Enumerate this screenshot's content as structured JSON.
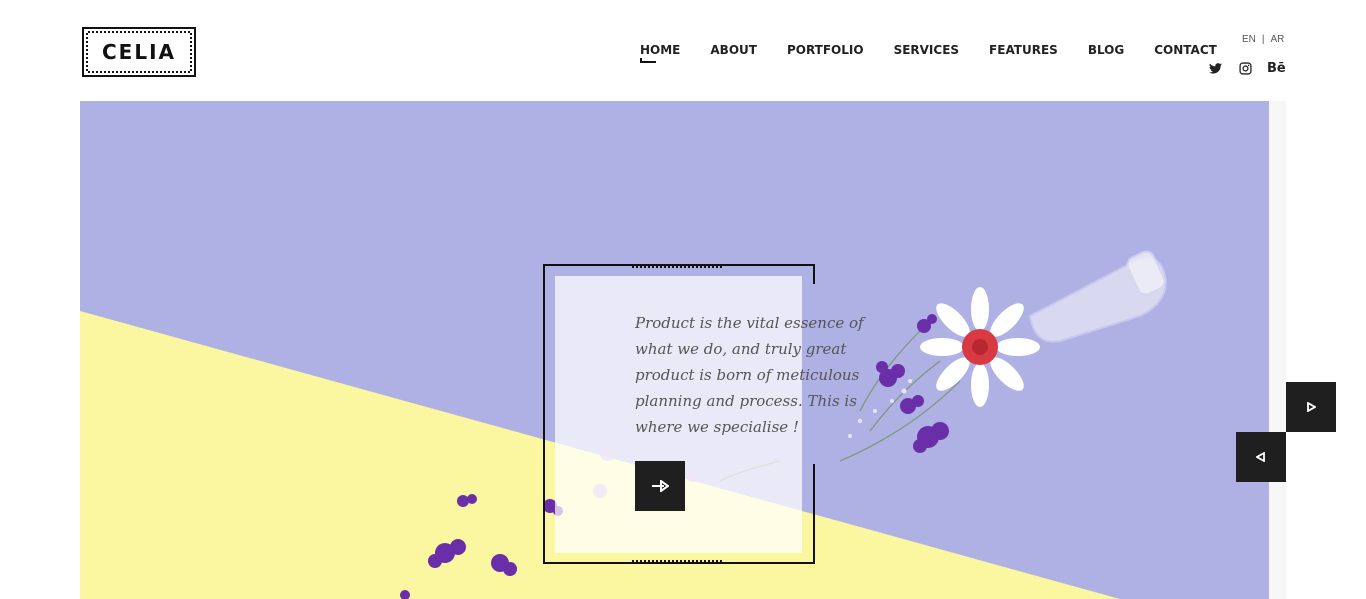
{
  "brand": {
    "logo_text": "CELIA"
  },
  "nav": {
    "items": [
      {
        "label": "HOME",
        "active": true
      },
      {
        "label": "ABOUT"
      },
      {
        "label": "PORTFOLIO"
      },
      {
        "label": "SERVICES"
      },
      {
        "label": "FEATURES"
      },
      {
        "label": "BLOG"
      },
      {
        "label": "CONTACT"
      }
    ]
  },
  "language": {
    "en": "EN",
    "separator": "|",
    "ar": "AR"
  },
  "social": [
    {
      "icon": "twitter-icon"
    },
    {
      "icon": "instagram-icon"
    },
    {
      "icon": "behance-icon",
      "label": "Bē"
    }
  ],
  "hero": {
    "quote": "Product is the vital essence of what we do, and truly great product is born of meticulous planning and process. This is where we specialise !",
    "cta_icon": "arrow-right-icon",
    "background_colors": {
      "lavender": "#afb0e3",
      "yellow": "#fbf6a0"
    }
  },
  "slider": {
    "next_icon": "play-right-icon",
    "prev_icon": "play-left-icon"
  },
  "colors": {
    "accent_dark": "#1f1f1f",
    "text": "#222222"
  }
}
